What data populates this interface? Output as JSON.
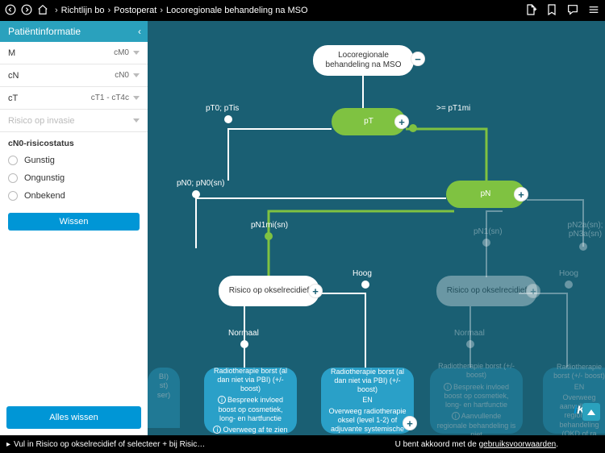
{
  "topbar": {
    "crumbs": [
      "Richtlijn bo",
      "Postoperat",
      "Locoregionale behandeling na MSO"
    ]
  },
  "sidebar": {
    "title": "Patiëntinformatie",
    "rows": [
      {
        "label": "M",
        "value": "cM0"
      },
      {
        "label": "cN",
        "value": "cN0"
      },
      {
        "label": "cT",
        "value": "cT1 - cT4c"
      }
    ],
    "disabled_row": "Risico op invasie",
    "section": "cN0-risicostatus",
    "radios": [
      "Gunstig",
      "Ongunstig",
      "Onbekend"
    ],
    "wissen": "Wissen",
    "alles": "Alles wissen"
  },
  "flow": {
    "root": "Locoregionale behandeling na MSO",
    "pT": "pT",
    "pN": "pN",
    "risk": "Risico op okselrecidief",
    "risk2": "Risico op okselrecidief",
    "pT_left": "pT0; pTis",
    "pT_right": ">= pT1mi",
    "pN_left": "pN0; pN0(sn)",
    "pN1mi": "pN1mi(sn)",
    "pN1": "pN1(sn)",
    "pN2": "pN2a(sn); pN3a(sn)",
    "hoog": "Hoog",
    "hoog2": "Hoog",
    "normaal": "Normaal",
    "normaal2": "Normaal",
    "card1_t": "Radiotherapie borst (al dan niet via PBI) (+/- boost)",
    "card1_b1": "Bespreek invloed boost op cosmetiek, long- en hartfunctie",
    "card1_b2": "Overweeg af te zien",
    "card2_t": "Radiotherapie borst (al dan niet via PBI) (+/- boost)",
    "card2_m": "EN",
    "card2_b": "Overweeg radiotherapie oksel (level 1-2) of adjuvante systemische",
    "card3_t": "Radiotherapie borst (+/- boost)",
    "card3_b1": "Bespreek invloed boost op cosmetiek, long- en hartfunctie",
    "card3_b2": "Aanvullende regionale behandeling is niet",
    "card4_t": "Radiotherapie borst (+/- boost)",
    "card4_m": "EN",
    "card4_b": "Overweeg aanvullende regionale behandeling (OKD of ra",
    "partial_left": "BI)\nst)\nser)"
  },
  "bottom": {
    "hint": "Vul in Risico op okselrecidief of selecteer + bij Risic…",
    "right1": "U bent akkoord met de ",
    "right2": "gebruiksvoorwaarden",
    "right3": "."
  }
}
